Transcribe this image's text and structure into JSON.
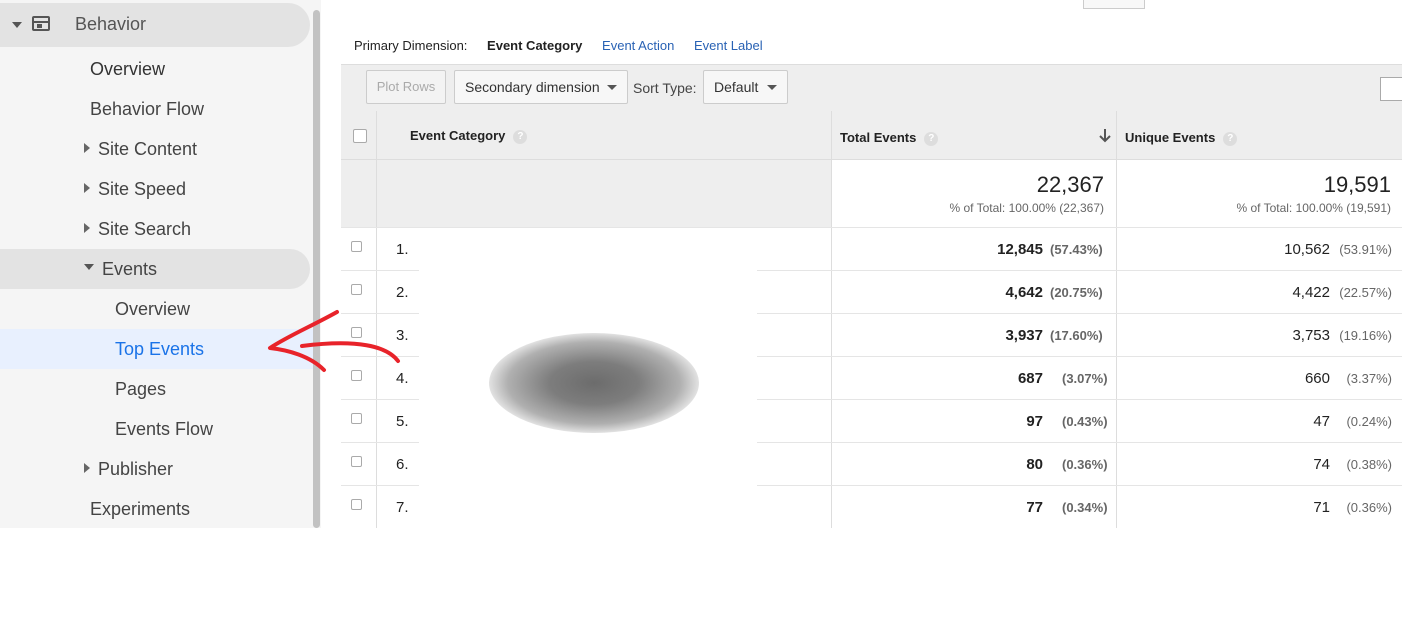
{
  "sidebar": {
    "section": "Behavior",
    "items": [
      {
        "label": "Overview"
      },
      {
        "label": "Behavior Flow"
      },
      {
        "label": "Site Content"
      },
      {
        "label": "Site Speed"
      },
      {
        "label": "Site Search"
      },
      {
        "label": "Events"
      },
      {
        "label": "Overview"
      },
      {
        "label": "Top Events"
      },
      {
        "label": "Pages"
      },
      {
        "label": "Events Flow"
      },
      {
        "label": "Publisher"
      },
      {
        "label": "Experiments"
      }
    ]
  },
  "dimensions": {
    "label": "Primary Dimension:",
    "current": "Event Category",
    "options": [
      "Event Action",
      "Event Label"
    ]
  },
  "toolbar": {
    "plot_rows": "Plot Rows",
    "secondary_dimension": "Secondary dimension",
    "sort_type_label": "Sort Type:",
    "sort_type_value": "Default"
  },
  "table": {
    "headers": {
      "category": "Event Category",
      "total": "Total Events",
      "unique": "Unique Events",
      "help": "?"
    },
    "totals": {
      "total_value": "22,367",
      "total_pct": "% of Total: 100.00% (22,367)",
      "unique_value": "19,591",
      "unique_pct": "% of Total: 100.00% (19,591)"
    },
    "rows": [
      {
        "num": "1.",
        "total": "12,845",
        "total_pct": "(57.43%)",
        "unique": "10,562",
        "unique_pct": "(53.91%)"
      },
      {
        "num": "2.",
        "total": "4,642",
        "total_pct": "(20.75%)",
        "unique": "4,422",
        "unique_pct": "(22.57%)"
      },
      {
        "num": "3.",
        "total": "3,937",
        "total_pct": "(17.60%)",
        "unique": "3,753",
        "unique_pct": "(19.16%)"
      },
      {
        "num": "4.",
        "total": "687",
        "total_pct": "(3.07%)",
        "unique": "660",
        "unique_pct": "(3.37%)"
      },
      {
        "num": "5.",
        "total": "97",
        "total_pct": "(0.43%)",
        "unique": "47",
        "unique_pct": "(0.24%)"
      },
      {
        "num": "6.",
        "total": "80",
        "total_pct": "(0.36%)",
        "unique": "74",
        "unique_pct": "(0.38%)"
      },
      {
        "num": "7.",
        "total": "77",
        "total_pct": "(0.34%)",
        "unique": "71",
        "unique_pct": "(0.36%)"
      }
    ]
  },
  "colors": {
    "accent": "#1a73e8",
    "arrow": "#e8232a",
    "link": "#2962b4"
  }
}
